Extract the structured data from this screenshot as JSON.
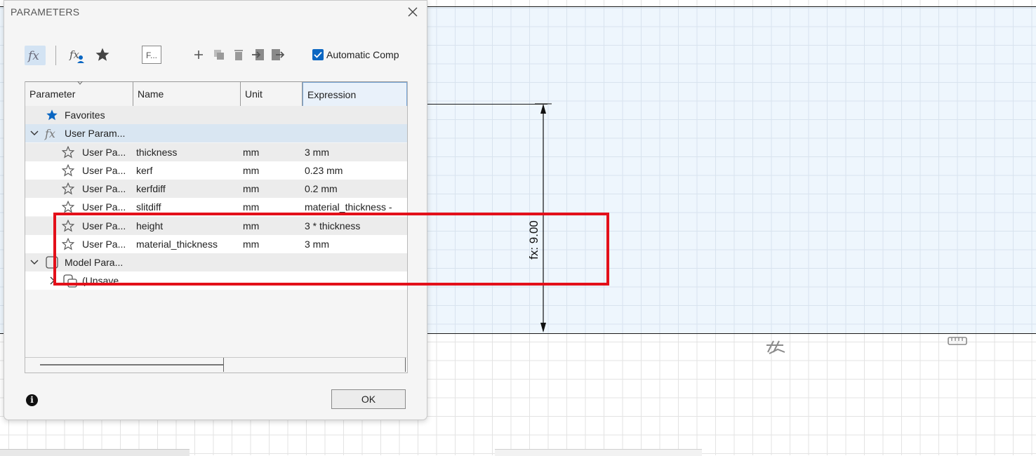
{
  "dialog": {
    "title": "PARAMETERS",
    "toolbar": {
      "filter_placeholder": "F...",
      "auto_compute_label": "Automatic Comp"
    },
    "columns": [
      "Parameter",
      "Name",
      "Unit",
      "Expression"
    ],
    "groups": {
      "favorites_label": "Favorites",
      "user_params_label": "User Param...",
      "model_params_label": "Model Para...",
      "unsaved_label": "(Unsave..."
    },
    "rows": [
      {
        "param": "User Pa...",
        "name": "thickness",
        "unit": "mm",
        "expression": "3 mm"
      },
      {
        "param": "User Pa...",
        "name": "kerf",
        "unit": "mm",
        "expression": "0.23 mm"
      },
      {
        "param": "User Pa...",
        "name": "kerfdiff",
        "unit": "mm",
        "expression": "0.2 mm"
      },
      {
        "param": "User Pa...",
        "name": "slitdiff",
        "unit": "mm",
        "expression": "material_thickness -"
      },
      {
        "param": "User Pa...",
        "name": "height",
        "unit": "mm",
        "expression": "3 * thickness"
      },
      {
        "param": "User Pa...",
        "name": "material_thickness",
        "unit": "mm",
        "expression": "3 mm"
      }
    ],
    "ok_label": "OK",
    "info_glyph": "i"
  },
  "canvas": {
    "dimension_label": "fx: 9.00"
  },
  "colors": {
    "accent": "#0a66c2",
    "highlight": "#e3101a",
    "sketch_fill": "#eef6fd",
    "selected_row": "#d9e6f2"
  },
  "icons": {
    "close": "close-icon",
    "fx": "fx-icon",
    "user_fx": "user-fx-icon",
    "star": "star-icon",
    "add": "plus-icon",
    "copy": "copy-icon",
    "delete": "trash-icon",
    "import": "import-icon",
    "export": "export-icon",
    "info": "info-icon"
  }
}
